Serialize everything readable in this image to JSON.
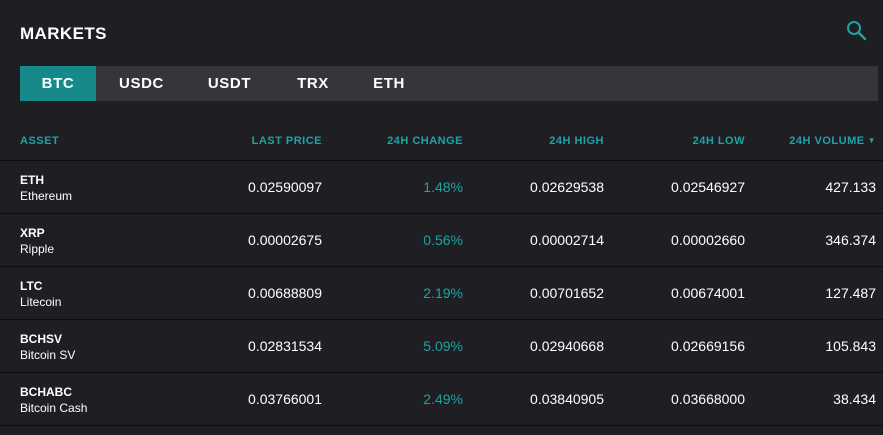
{
  "header": {
    "title": "MARKETS",
    "search_icon": "search-icon",
    "accent_color": "#1aa5a5"
  },
  "tabs": [
    {
      "label": "BTC",
      "active": true
    },
    {
      "label": "USDC",
      "active": false
    },
    {
      "label": "USDT",
      "active": false
    },
    {
      "label": "TRX",
      "active": false
    },
    {
      "label": "ETH",
      "active": false
    }
  ],
  "table": {
    "columns": {
      "asset": "ASSET",
      "last_price": "LAST PRICE",
      "change": "24H CHANGE",
      "high": "24H HIGH",
      "low": "24H LOW",
      "volume": "24H VOLUME"
    },
    "sort_indicator": "▼",
    "rows": [
      {
        "symbol": "ETH",
        "name": "Ethereum",
        "last_price": "0.02590097",
        "change": "1.48%",
        "high": "0.02629538",
        "low": "0.02546927",
        "volume": "427.133"
      },
      {
        "symbol": "XRP",
        "name": "Ripple",
        "last_price": "0.00002675",
        "change": "0.56%",
        "high": "0.00002714",
        "low": "0.00002660",
        "volume": "346.374"
      },
      {
        "symbol": "LTC",
        "name": "Litecoin",
        "last_price": "0.00688809",
        "change": "2.19%",
        "high": "0.00701652",
        "low": "0.00674001",
        "volume": "127.487"
      },
      {
        "symbol": "BCHSV",
        "name": "Bitcoin SV",
        "last_price": "0.02831534",
        "change": "5.09%",
        "high": "0.02940668",
        "low": "0.02669156",
        "volume": "105.843"
      },
      {
        "symbol": "BCHABC",
        "name": "Bitcoin Cash",
        "last_price": "0.03766001",
        "change": "2.49%",
        "high": "0.03840905",
        "low": "0.03668000",
        "volume": "38.434"
      }
    ]
  }
}
